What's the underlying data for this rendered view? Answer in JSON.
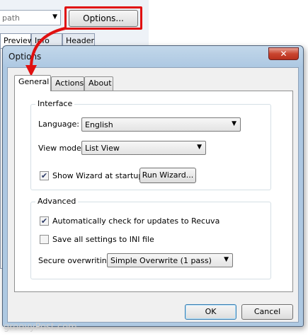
{
  "background_window": {
    "path_field": "path",
    "options_button": "Options...",
    "tabs": [
      "Preview",
      "Info",
      "Header"
    ]
  },
  "dialog": {
    "title": "Options",
    "close_glyph": "✕",
    "tabs": [
      {
        "label": "General",
        "active": true
      },
      {
        "label": "Actions",
        "active": false
      },
      {
        "label": "About",
        "active": false
      }
    ],
    "interface": {
      "group_label": "Interface",
      "language_label": "Language:",
      "language_value": "English",
      "view_mode_label": "View mode",
      "view_mode_value": "List View",
      "show_wizard_label": "Show Wizard at startup",
      "show_wizard_checked": true,
      "run_wizard_button": "Run Wizard..."
    },
    "advanced": {
      "group_label": "Advanced",
      "auto_update_label": "Automatically check for updates to Recuva",
      "auto_update_checked": true,
      "ini_label": "Save all settings to INI file",
      "ini_checked": false,
      "secure_overwrite_label": "Secure overwriting",
      "secure_overwrite_value": "Simple Overwrite (1 pass)"
    },
    "ok_button": "OK",
    "cancel_button": "Cancel"
  },
  "watermark": "groovyPost.com",
  "colors": {
    "highlight": "#e01010",
    "titlebar": "#b4cde6",
    "close_button": "#c9452f"
  }
}
